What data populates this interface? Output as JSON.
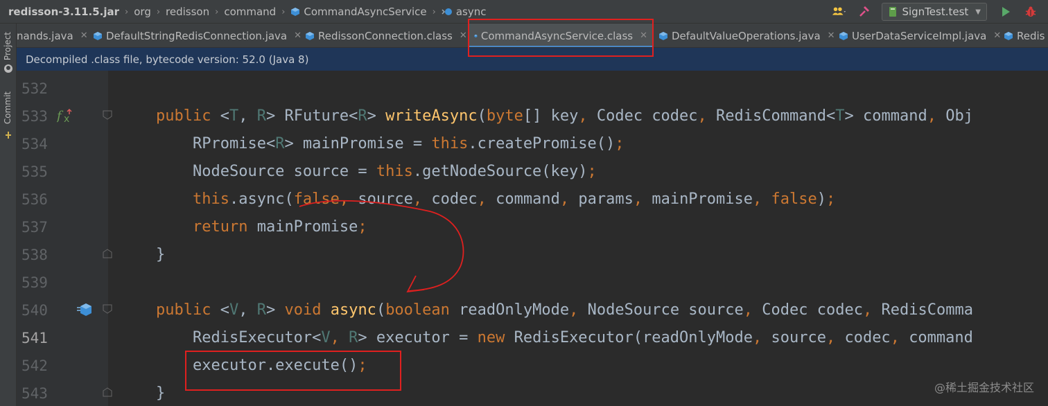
{
  "breadcrumb": {
    "jar": "redisson-3.11.5.jar",
    "items": [
      "org",
      "redisson",
      "command",
      "CommandAsyncService",
      "async"
    ]
  },
  "toolbar": {
    "run_config": "SignTest.test"
  },
  "toolstrip": {
    "project": "Project",
    "commit": "Commit"
  },
  "tabs": [
    {
      "label": "nands.java"
    },
    {
      "label": "DefaultStringRedisConnection.java"
    },
    {
      "label": "RedissonConnection.class"
    },
    {
      "label": "CommandAsyncService.class",
      "active": true
    },
    {
      "label": "DefaultValueOperations.java"
    },
    {
      "label": "UserDataServiceImpl.java"
    },
    {
      "label": "Redis"
    }
  ],
  "banner": "Decompiled .class file, bytecode version: 52.0 (Java 8)",
  "editor": {
    "current_line": 541,
    "lines": [
      {
        "n": "532",
        "tokens": []
      },
      {
        "n": "533",
        "tokens": [
          [
            "kw",
            "public "
          ],
          [
            "pl",
            "<"
          ],
          [
            "tp",
            "T"
          ],
          [
            "pl",
            ", "
          ],
          [
            "tp",
            "R"
          ],
          [
            "pl",
            "> RFuture<"
          ],
          [
            "tp",
            "R"
          ],
          [
            "pl",
            "> "
          ],
          [
            "fn",
            "writeAsync"
          ],
          [
            "pl",
            "("
          ],
          [
            "kw",
            "byte"
          ],
          [
            "pl",
            "[] key"
          ],
          [
            "kw",
            ", "
          ],
          [
            "pl",
            "Codec codec"
          ],
          [
            "kw",
            ", "
          ],
          [
            "pl",
            "RedisCommand<"
          ],
          [
            "tp",
            "T"
          ],
          [
            "pl",
            "> command"
          ],
          [
            "kw",
            ", "
          ],
          [
            "pl",
            "Obj"
          ]
        ]
      },
      {
        "n": "534",
        "tokens": [
          [
            "pl",
            "    RPromise<"
          ],
          [
            "tp",
            "R"
          ],
          [
            "pl",
            "> mainPromise = "
          ],
          [
            "kw",
            "this"
          ],
          [
            "pl",
            ".createPromise()"
          ],
          [
            "kw",
            ";"
          ]
        ]
      },
      {
        "n": "535",
        "tokens": [
          [
            "pl",
            "    NodeSource source = "
          ],
          [
            "kw",
            "this"
          ],
          [
            "pl",
            ".getNodeSource(key)"
          ],
          [
            "kw",
            ";"
          ]
        ]
      },
      {
        "n": "536",
        "tokens": [
          [
            "kw",
            "    this"
          ],
          [
            "pl",
            ".async("
          ],
          [
            "kw",
            "false, "
          ],
          [
            "pl",
            "source"
          ],
          [
            "kw",
            ", "
          ],
          [
            "pl",
            "codec"
          ],
          [
            "kw",
            ", "
          ],
          [
            "pl",
            "command"
          ],
          [
            "kw",
            ", "
          ],
          [
            "pl",
            "params"
          ],
          [
            "kw",
            ", "
          ],
          [
            "pl",
            "mainPromise"
          ],
          [
            "kw",
            ", false"
          ],
          [
            "pl",
            ")"
          ],
          [
            "kw",
            ";"
          ]
        ]
      },
      {
        "n": "537",
        "tokens": [
          [
            "kw",
            "    return "
          ],
          [
            "pl",
            "mainPromise"
          ],
          [
            "kw",
            ";"
          ]
        ]
      },
      {
        "n": "538",
        "tokens": [
          [
            "pl",
            "}"
          ]
        ]
      },
      {
        "n": "539",
        "tokens": []
      },
      {
        "n": "540",
        "tokens": [
          [
            "kw",
            "public "
          ],
          [
            "pl",
            "<"
          ],
          [
            "tp",
            "V"
          ],
          [
            "pl",
            ", "
          ],
          [
            "tp",
            "R"
          ],
          [
            "pl",
            "> "
          ],
          [
            "kw",
            "void "
          ],
          [
            "fn",
            "async"
          ],
          [
            "pl",
            "("
          ],
          [
            "kw",
            "boolean "
          ],
          [
            "pl",
            "readOnlyMode"
          ],
          [
            "kw",
            ", "
          ],
          [
            "pl",
            "NodeSource source"
          ],
          [
            "kw",
            ", "
          ],
          [
            "pl",
            "Codec codec"
          ],
          [
            "kw",
            ", "
          ],
          [
            "pl",
            "RedisComma"
          ]
        ]
      },
      {
        "n": "541",
        "tokens": [
          [
            "pl",
            "    RedisExecutor<"
          ],
          [
            "tp",
            "V"
          ],
          [
            "kw",
            ", "
          ],
          [
            "tp",
            "R"
          ],
          [
            "pl",
            "> executor = "
          ],
          [
            "kw",
            "new "
          ],
          [
            "pl",
            "RedisExecutor(readOnlyMode"
          ],
          [
            "kw",
            ", "
          ],
          [
            "pl",
            "source"
          ],
          [
            "kw",
            ", "
          ],
          [
            "pl",
            "codec"
          ],
          [
            "kw",
            ", "
          ],
          [
            "pl",
            "command"
          ]
        ]
      },
      {
        "n": "542",
        "tokens": [
          [
            "pl",
            "    executor.execute()"
          ],
          [
            "kw",
            ";"
          ]
        ]
      },
      {
        "n": "543",
        "tokens": [
          [
            "pl",
            "}"
          ]
        ]
      }
    ]
  },
  "watermark": "@稀土掘金技术社区",
  "colors": {
    "accent": "#4a88c7",
    "selection": "#2d5fa0",
    "annotation": "#e0201f"
  }
}
